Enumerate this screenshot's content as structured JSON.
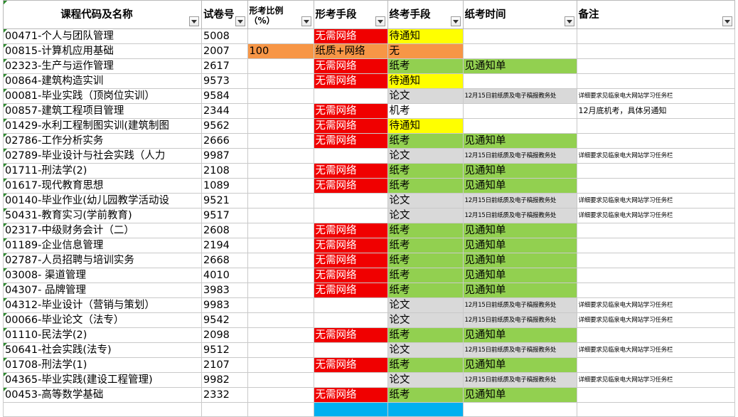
{
  "headers": {
    "course": "课程代码及名称",
    "paper_no": "试卷号",
    "ratio": "形考比例（%）",
    "formative": "形考手段",
    "final": "终考手段",
    "exam_time": "纸考时间",
    "remark": "备注"
  },
  "rows": [
    {
      "course": "00471-个人与团队管理",
      "paper": "5008",
      "ratio": "",
      "formative": "无需网络",
      "final": "待通知",
      "time": "",
      "remark": ""
    },
    {
      "course": "00815-计算机应用基础",
      "paper": "2007",
      "ratio": "100",
      "formative": "纸质+网络",
      "final": "无",
      "time": "",
      "remark": ""
    },
    {
      "course": "02323-生产与运作管理",
      "paper": "2617",
      "ratio": "",
      "formative": "无需网络",
      "final": "纸考",
      "time": "见通知单",
      "remark": ""
    },
    {
      "course": "00864-建筑构造实训",
      "paper": "9573",
      "ratio": "",
      "formative": "无需网络",
      "final": "待通知",
      "time": "",
      "remark": ""
    },
    {
      "course": "00081-毕业实践（顶岗位实训）",
      "paper": "9584",
      "ratio": "",
      "formative": "",
      "final": "论文",
      "time": "12月15日前纸质及电子稿报教务处",
      "remark": "详细要求见临泉电大网站学习任务栏"
    },
    {
      "course": "00857-建筑工程项目管理",
      "paper": "2344",
      "ratio": "",
      "formative": "无需网络",
      "final": "机考",
      "time": "",
      "remark": "12月底机考，具体另通知"
    },
    {
      "course": "01429-水利工程制图实训(建筑制图",
      "paper": "9562",
      "ratio": "",
      "formative": "无需网络",
      "final": "待通知",
      "time": "",
      "remark": ""
    },
    {
      "course": "02786-工作分析实务",
      "paper": "2666",
      "ratio": "",
      "formative": "无需网络",
      "final": "纸考",
      "time": "见通知单",
      "remark": ""
    },
    {
      "course": "02789-毕业设计与社会实践（人力",
      "paper": "9987",
      "ratio": "",
      "formative": "",
      "final": "论文",
      "time": "12月15日前纸质及电子稿报教务处",
      "remark": "详细要求见临泉电大网站学习任务栏"
    },
    {
      "course": "01711-刑法学(2)",
      "paper": "2108",
      "ratio": "",
      "formative": "无需网络",
      "final": "纸考",
      "time": "见通知单",
      "remark": ""
    },
    {
      "course": "01617-现代教育思想",
      "paper": "1089",
      "ratio": "",
      "formative": "无需网络",
      "final": "纸考",
      "time": "见通知单",
      "remark": ""
    },
    {
      "course": "00140-毕业作业(幼儿园教学活动设",
      "paper": "9521",
      "ratio": "",
      "formative": "",
      "final": "论文",
      "time": "12月15日前纸质及电子稿报教务处",
      "remark": "详细要求见临泉电大网站学习任务栏"
    },
    {
      "course": "50431-教育实习(学前教育)",
      "paper": "9517",
      "ratio": "",
      "formative": "",
      "final": "论文",
      "time": "12月15日前纸质及电子稿报教务处",
      "remark": "详细要求见临泉电大网站学习任务栏"
    },
    {
      "course": "02317-中级财务会计（二）",
      "paper": "2608",
      "ratio": "",
      "formative": "无需网络",
      "final": "纸考",
      "time": "见通知单",
      "remark": ""
    },
    {
      "course": "01189-企业信息管理",
      "paper": "2194",
      "ratio": "",
      "formative": "无需网络",
      "final": "纸考",
      "time": "见通知单",
      "remark": ""
    },
    {
      "course": "02787-人员招聘与培训实务",
      "paper": "2668",
      "ratio": "",
      "formative": "无需网络",
      "final": "纸考",
      "time": "见通知单",
      "remark": ""
    },
    {
      "course": "03008- 渠道管理",
      "paper": "4010",
      "ratio": "",
      "formative": "无需网络",
      "final": "纸考",
      "time": "见通知单",
      "remark": ""
    },
    {
      "course": "04307- 品牌管理",
      "paper": "3983",
      "ratio": "",
      "formative": "无需网络",
      "final": "纸考",
      "time": "见通知单",
      "remark": ""
    },
    {
      "course": "04312-毕业设计（营销与策划）",
      "paper": "9983",
      "ratio": "",
      "formative": "",
      "final": "论文",
      "time": "12月15日前纸质及电子稿报教务处",
      "remark": "详细要求见临泉电大网站学习任务栏"
    },
    {
      "course": "00066-毕业论文（法专）",
      "paper": "9542",
      "ratio": "",
      "formative": "",
      "final": "论文",
      "time": "12月15日前纸质及电子稿报教务处",
      "remark": "详细要求见临泉电大网站学习任务栏"
    },
    {
      "course": "01110-民法学(2)",
      "paper": "2098",
      "ratio": "",
      "formative": "无需网络",
      "final": "纸考",
      "time": "见通知单",
      "remark": ""
    },
    {
      "course": "50641-社会实践(法专)",
      "paper": "9512",
      "ratio": "",
      "formative": "",
      "final": "论文",
      "time": "12月15日前纸质及电子稿报教务处",
      "remark": "详细要求见临泉电大网站学习任务栏"
    },
    {
      "course": "01708-刑法学(1)",
      "paper": "2107",
      "ratio": "",
      "formative": "无需网络",
      "final": "纸考",
      "time": "见通知单",
      "remark": ""
    },
    {
      "course": "04365-毕业实践(建设工程管理)",
      "paper": "9982",
      "ratio": "",
      "formative": "",
      "final": "论文",
      "time": "12月15日前纸质及电子稿报教务处",
      "remark": "详细要求见临泉电大网站学习任务栏"
    },
    {
      "course": "00453-高等数学基础",
      "paper": "2332",
      "ratio": "",
      "formative": "无需网络",
      "final": "纸考",
      "time": "见通知单",
      "remark": ""
    }
  ],
  "colors": {
    "red": "#f00000",
    "yellow": "#ffff00",
    "green": "#92d050",
    "gray": "#d9d9d9",
    "orange": "#f79646",
    "cyan": "#00b0f0"
  },
  "icons": {
    "filter": "filter-dropdown-icon"
  }
}
